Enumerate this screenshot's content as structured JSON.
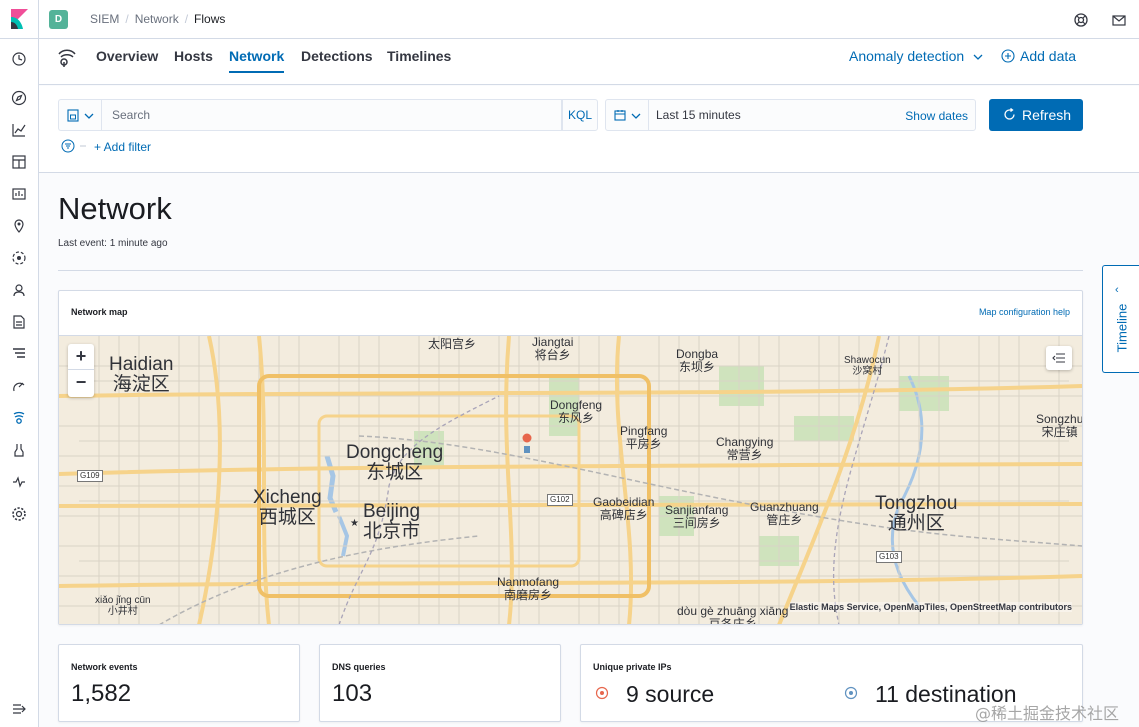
{
  "header": {
    "space_initial": "D",
    "breadcrumbs": [
      "SIEM",
      "Network",
      "Flows"
    ]
  },
  "nav": {
    "tabs": [
      "Overview",
      "Hosts",
      "Network",
      "Detections",
      "Timelines"
    ],
    "active_tab": "Network",
    "anomaly_detection": "Anomaly detection",
    "add_data": "Add data"
  },
  "query": {
    "search_placeholder": "Search",
    "language": "KQL",
    "time_range": "Last 15 minutes",
    "show_dates": "Show dates",
    "refresh": "Refresh",
    "add_filter": "+ Add filter"
  },
  "page": {
    "title": "Network",
    "last_event": "Last event: 1 minute ago"
  },
  "map": {
    "title": "Network map",
    "help": "Map configuration help",
    "attribution": "Elastic Maps Service, OpenMapTiles, OpenStreetMap contributors",
    "labels": {
      "haidian": "Haidian\n海淀区",
      "dongcheng": "Dongcheng\n东城区",
      "xicheng": "Xicheng\n西城区",
      "beijing": "Beijing\n北京市",
      "tongzhou": "Tongzhou\n通州区",
      "taiyang": "太阳宫乡",
      "jiangtai": "Jiangtai\n将台乡",
      "dongba": "Dongba\n东坝乡",
      "shawocun": "Shawocun\n沙窝村",
      "dongfeng": "Dongfeng\n东风乡",
      "pingfang": "Pingfang\n平房乡",
      "changying": "Changying\n常营乡",
      "songzhuang": "Songzhu\n宋庄镇",
      "gaobeidian": "Gaobeidian\n高碑店乡",
      "sanjianfang": "Sanjianfang\n三间房乡",
      "guanzhuang": "Guanzhuang\n管庄乡",
      "nanmofang": "Nanmofang\n南磨房乡",
      "xiaojingcun": "xiǎo jǐng cūn\n小井村",
      "douge": "dòu gè zhuāng xiāng\n豆各庄乡"
    },
    "road_signs": [
      "G109",
      "G102",
      "G103"
    ]
  },
  "stats": {
    "network_events": {
      "label": "Network events",
      "value": "1,582"
    },
    "dns_queries": {
      "label": "DNS queries",
      "value": "103"
    },
    "unique_private_ips": {
      "label": "Unique private IPs",
      "source": "9 source",
      "destination": "11 destination"
    }
  },
  "timeline": {
    "label": "Timeline"
  },
  "watermark": "@稀土掘金技术社区",
  "colors": {
    "accent": "#006bb4",
    "space_badge": "#54b399",
    "source_icon": "#e7664c"
  }
}
